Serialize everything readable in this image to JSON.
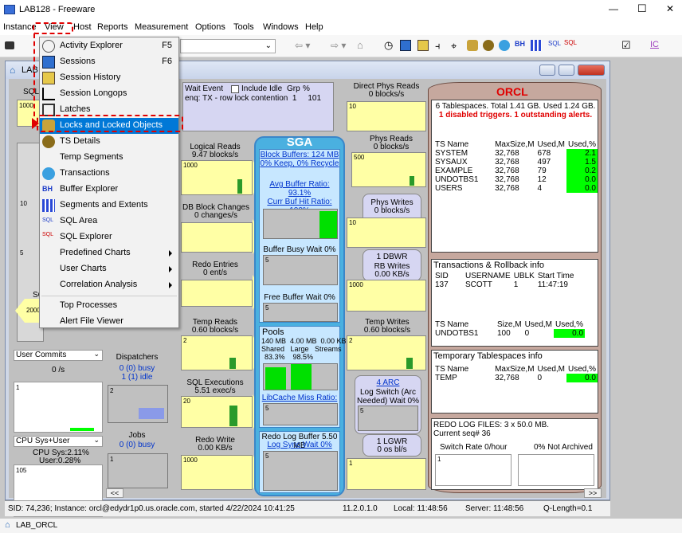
{
  "window": {
    "title": "LAB128 - Freeware",
    "controls": {
      "minimize": "—",
      "maximize": "☐",
      "close": "✕"
    }
  },
  "menubar": [
    "Instance",
    "View",
    "Host",
    "Reports",
    "Measurement",
    "Options",
    "Tools",
    "Windows",
    "Help"
  ],
  "view_menu": {
    "items": [
      {
        "label": "Activity Explorer",
        "shortcut": "F5",
        "icon": "activity-icon"
      },
      {
        "label": "Sessions",
        "shortcut": "F6",
        "icon": "sessions-icon"
      },
      {
        "label": "Session History",
        "shortcut": "",
        "icon": "history-icon"
      },
      {
        "label": "Session Longops",
        "shortcut": "",
        "icon": "longops-icon"
      },
      {
        "label": "Latches",
        "shortcut": "",
        "icon": "latch-icon"
      },
      {
        "label": "Locks and Locked Objects",
        "shortcut": "",
        "icon": "lock-icon",
        "selected": true
      },
      {
        "label": "TS Details",
        "shortcut": "",
        "icon": "ts-icon"
      },
      {
        "label": "Temp Segments",
        "shortcut": "",
        "icon": ""
      },
      {
        "label": "Transactions",
        "shortcut": "",
        "icon": "transactions-icon"
      },
      {
        "label": "Buffer Explorer",
        "shortcut": "",
        "icon": "bh-icon"
      },
      {
        "label": "Segments and Extents",
        "shortcut": "",
        "icon": "segments-icon"
      },
      {
        "label": "SQL Area",
        "shortcut": "",
        "icon": "sql-icon"
      },
      {
        "label": "SQL Explorer",
        "shortcut": "",
        "icon": "sql-explorer-icon"
      },
      {
        "label": "Predefined Charts",
        "submenu": true
      },
      {
        "label": "User Charts",
        "submenu": true
      },
      {
        "label": "Correlation Analysis",
        "submenu": true
      },
      {
        "label": "Top Processes"
      },
      {
        "label": "Alert File Viewer"
      }
    ]
  },
  "child": {
    "title": "LAB",
    "sqln": "SQLN",
    "sql2": "SQL"
  },
  "metrics": {
    "wait_event": "Wait Event",
    "include_idle": "Include Idle",
    "grp": "Grp",
    "pct": "%",
    "wait_row": "enq: TX - row lock contention  1     101",
    "direct_phys_reads": "Direct Phys Reads",
    "direct_phys_reads_val": "0 blocks/s",
    "logical_reads": "Logical Reads",
    "logical_reads_val": "9.47 blocks/s",
    "phys_reads": "Phys Reads",
    "phys_reads_val": "0 blocks/s",
    "db_block_changes": "DB Block Changes",
    "db_block_changes_val": "0 changes/s",
    "phys_writes": "Phys Writes",
    "phys_writes_val": "0 blocks/s",
    "redo_entries": "Redo Entries",
    "redo_entries_val": "0 ent/s",
    "dbwr": "1 DBWR",
    "rb_writes": "RB Writes",
    "rb_writes_val": "0.00 KB/s",
    "temp_reads": "Temp Reads",
    "temp_reads_val": "0.60 blocks/s",
    "temp_writes": "Temp Writes",
    "temp_writes_val": "0.60 blocks/s",
    "sql_exec": "SQL Executions",
    "sql_exec_val": "5.51 exec/s",
    "redo_write": "Redo Write",
    "redo_write_val": "0.00 KB/s",
    "arc": "4 ARC",
    "log_switch": "Log Switch (Arc Needed) Wait 0%",
    "lgwr": "1 LGWR",
    "lgwr_val": "0 os bl/s",
    "user_commits": "User Commits",
    "user_commits_val": "0 /s",
    "dispatchers": "Dispatchers",
    "disp_busy": "0 (0) busy",
    "disp_idle": "1 (1) idle",
    "cpu": "CPU Sys+User",
    "cpu_sys": "CPU Sys:2.11%",
    "cpu_user": "User:0.28%",
    "jobs": "Jobs",
    "jobs_busy": "0 (0) busy",
    "scale_1000": "1000",
    "scale_10": "10",
    "scale_5": "5",
    "scale_500": "500",
    "scale_2": "2",
    "scale_20": "20",
    "scale_1": "1",
    "scale_105": "105",
    "scale_2000": "20000"
  },
  "sga": {
    "title": "SGA",
    "block_buffers": "Block Buffers: 124 MB",
    "keep_recycle": "0% Keep, 0% Recycle",
    "avg_buffer": "Avg Buffer Ratio: 93.1%",
    "cur_hit": "Curr Buf Hit Ratio: 100%",
    "buffer_busy": "Buffer Busy Wait  0%",
    "free_buffer": "Free Buffer Wait  0%",
    "pools": "Pools",
    "pools_row1": "140 MB  4.00 MB  0.00 KB",
    "pools_row2": "Shared   Large   Streams",
    "pools_row3": "83.3%    98.5%",
    "libcache": "LibCache Miss Ratio: 0%",
    "redo_log_buffer": "Redo Log Buffer 5.50 MB",
    "log_sync": "Log Sync Wait 0%"
  },
  "db": {
    "name": "ORCL",
    "summary": "6 Tablespaces. Total 1.41 GB. Used 1.24 GB.",
    "alerts": "1 disabled triggers. 1 outstanding alerts.",
    "ts_headers": [
      "TS Name",
      "MaxSize,M",
      "Used,M",
      "Used,%"
    ],
    "ts_rows": [
      [
        "SYSTEM",
        "32,768",
        "678",
        "2.1"
      ],
      [
        "SYSAUX",
        "32,768",
        "497",
        "1.5"
      ],
      [
        "EXAMPLE",
        "32,768",
        "79",
        "0.2"
      ],
      [
        "UNDOTBS1",
        "32,768",
        "12",
        "0.0"
      ],
      [
        "USERS",
        "32,768",
        "4",
        "0.0"
      ]
    ],
    "trans_title": "Transactions & Rollback info",
    "trans_headers": [
      "SID",
      "USERNAME",
      "UBLK",
      "Start Time"
    ],
    "trans_row": [
      "137",
      "SCOTT",
      "1",
      "11:47:19"
    ],
    "undo_headers": [
      "TS Name",
      "Size,M",
      "Used,M",
      "Used,%"
    ],
    "undo_row": [
      "UNDOTBS1",
      "100",
      "0",
      "0.0"
    ],
    "temp_title": "Temporary Tablespaces info",
    "temp_headers": [
      "TS Name",
      "MaxSize,M",
      "Used,M",
      "Used,%"
    ],
    "temp_row": [
      "TEMP",
      "32,768",
      "0",
      "0.0"
    ],
    "redo_files": "REDO LOG FILES: 3 x 50.0 MB.",
    "current_seq": "Current seq# 36",
    "switch_rate": "Switch Rate 0/hour",
    "not_archived": "0% Not Archived"
  },
  "status": {
    "sid": "SID: 74,236; Instance: orcl@edydr1p0.us.oracle.com, started 4/22/2024 10:41:25",
    "version": "11.2.0.1.0",
    "local": "Local: 11:48:56",
    "server": "Server: 11:48:56",
    "qlength": "Q-Length=0.1"
  },
  "taskbar": {
    "label": "LAB_ORCL"
  },
  "colors": {
    "accent_red": "#e00000",
    "highlight": "#0078d7",
    "yellow": "#ffffa5",
    "sga_blue": "#4ab0e0",
    "green": "#00ff00"
  }
}
